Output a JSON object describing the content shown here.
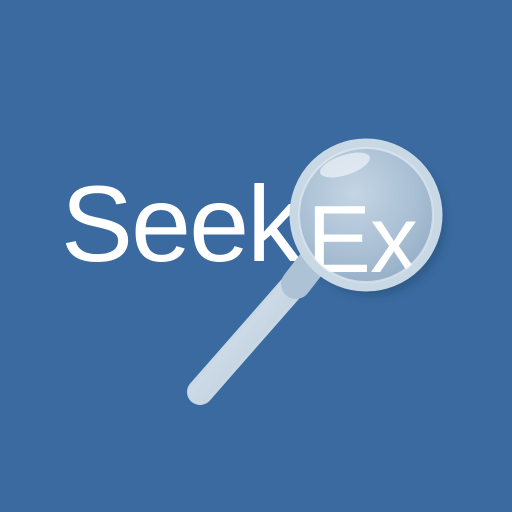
{
  "logo": {
    "word_part_1": "Seek",
    "word_part_2": "Ex"
  },
  "colors": {
    "background": "#3a6aa0",
    "text": "#ffffff",
    "magnifier_frame": "#c9d8e5",
    "lens_tint": "#a9bfd4"
  },
  "icons": {
    "magnifier": "magnifying-glass-icon"
  }
}
